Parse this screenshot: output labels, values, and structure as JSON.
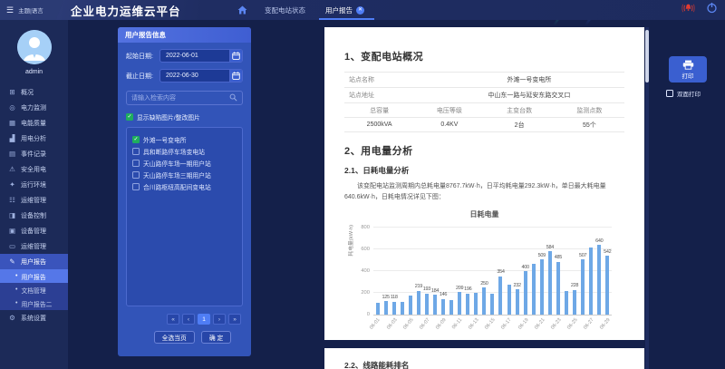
{
  "topbar": {
    "menu_label": "主题|语言",
    "title": "企业电力运维云平台",
    "tabs": [
      {
        "label": "变配电站状态",
        "active": false
      },
      {
        "label": "用户报告",
        "active": true,
        "closable": true
      }
    ]
  },
  "sidebar": {
    "username": "admin",
    "items": [
      {
        "label": "概况",
        "icon": "⊞",
        "icon_name": "overview-icon"
      },
      {
        "label": "电力监测",
        "icon": "◎",
        "icon_name": "power-monitor-icon"
      },
      {
        "label": "电能质量",
        "icon": "▦",
        "icon_name": "power-quality-icon"
      },
      {
        "label": "用电分析",
        "icon": "▟",
        "icon_name": "usage-analysis-icon"
      },
      {
        "label": "事件记录",
        "icon": "▤",
        "icon_name": "event-log-icon"
      },
      {
        "label": "安全用电",
        "icon": "⚠",
        "icon_name": "safety-icon"
      },
      {
        "label": "运行环境",
        "icon": "✦",
        "icon_name": "environment-icon"
      },
      {
        "label": "运维管理",
        "icon": "☷",
        "icon_name": "ops-management-icon"
      },
      {
        "label": "设备控制",
        "icon": "◨",
        "icon_name": "device-control-icon"
      },
      {
        "label": "设备管理",
        "icon": "▣",
        "icon_name": "device-management-icon"
      },
      {
        "label": "运维管理",
        "icon": "▭",
        "icon_name": "ops-management2-icon"
      },
      {
        "label": "用户报告",
        "icon": "✎",
        "icon_name": "user-report-icon",
        "active": true,
        "sub": [
          {
            "label": "用户报告",
            "active": true
          },
          {
            "label": "文档管理",
            "active": false
          },
          {
            "label": "用户报告二",
            "active": false
          }
        ]
      },
      {
        "label": "系统设置",
        "icon": "⚙",
        "icon_name": "settings-icon"
      }
    ]
  },
  "panel": {
    "header": "用户报告信息",
    "start_date_label": "起始日期:",
    "start_date": "2022-06-01",
    "end_date_label": "截止日期:",
    "end_date": "2022-06-30",
    "search_placeholder": "请输入检索内容",
    "image_toggle": {
      "label": "显示缺陷图片/整改图片",
      "checked": true
    },
    "stations": [
      {
        "name": "外滩一号变电所",
        "checked": true
      },
      {
        "name": "具和断路停车场变电站",
        "checked": false
      },
      {
        "name": "天山路停车场一期用户站",
        "checked": false
      },
      {
        "name": "天山路停车场三期用户站",
        "checked": false
      },
      {
        "name": "合川路枢纽高配间变电站",
        "checked": false
      }
    ],
    "pagination": {
      "buttons": [
        "«",
        "‹",
        "1",
        "›",
        "»"
      ],
      "current_index": 2
    },
    "select_all_label": "全选当页",
    "confirm_label": "确 定"
  },
  "report": {
    "section1_title": "1、变配电站概况",
    "info_rows": [
      {
        "label": "站点名称",
        "value": "外滩一号变电所"
      },
      {
        "label": "站点地址",
        "value": "中山东一路与延安东路交叉口"
      }
    ],
    "spec_headers": [
      "总容量",
      "电压等级",
      "主变台数",
      "监测点数"
    ],
    "spec_values": [
      "2500kVA",
      "0.4KV",
      "2台",
      "55个"
    ],
    "section2_title": "2、用电量分析",
    "section21_title": "2.1、日耗电量分析",
    "paragraph": "该变配电站监测周期内总耗电量8767.7kW·h，日平均耗电量292.3kW·h，单日最大耗电量640.6kW·h，日耗电情况详见下图：",
    "section22_title": "2.2、线路能耗排名"
  },
  "right_tools": {
    "print_label": "打印",
    "duplex_label": "双面打印",
    "duplex_checked": false
  },
  "chart_data": {
    "type": "bar",
    "title": "日耗电量",
    "ylabel": "耗电量(kW·h)",
    "ylim": [
      0,
      800
    ],
    "yticks": [
      0,
      200,
      400,
      600,
      800
    ],
    "grid": true,
    "legend": "none",
    "tick_every": 2,
    "bar_color": "#6ea8e6",
    "categories": [
      "06-01",
      "06-02",
      "06-03",
      "06-04",
      "06-05",
      "06-06",
      "06-07",
      "06-08",
      "06-09",
      "06-10",
      "06-11",
      "06-12",
      "06-13",
      "06-14",
      "06-15",
      "06-16",
      "06-17",
      "06-18",
      "06-19",
      "06-20",
      "06-21",
      "06-22",
      "06-23",
      "06-24",
      "06-25",
      "06-26",
      "06-27",
      "06-28",
      "06-29"
    ],
    "values": [
      108,
      125,
      118,
      115,
      178,
      219,
      193,
      184,
      146,
      138,
      209,
      196,
      198,
      250,
      196,
      354,
      280,
      232,
      400,
      466,
      509,
      584,
      485,
      215,
      228,
      507,
      620,
      640,
      542
    ],
    "label_shown": [
      false,
      true,
      true,
      false,
      false,
      true,
      true,
      true,
      true,
      false,
      true,
      true,
      false,
      true,
      false,
      true,
      false,
      true,
      true,
      false,
      true,
      true,
      true,
      false,
      true,
      true,
      false,
      true,
      true
    ]
  },
  "colors": {
    "accent": "#4f7df5",
    "bar": "#6ea8e6",
    "check_green": "#1fae5e",
    "alarm_red": "#e23b30"
  }
}
